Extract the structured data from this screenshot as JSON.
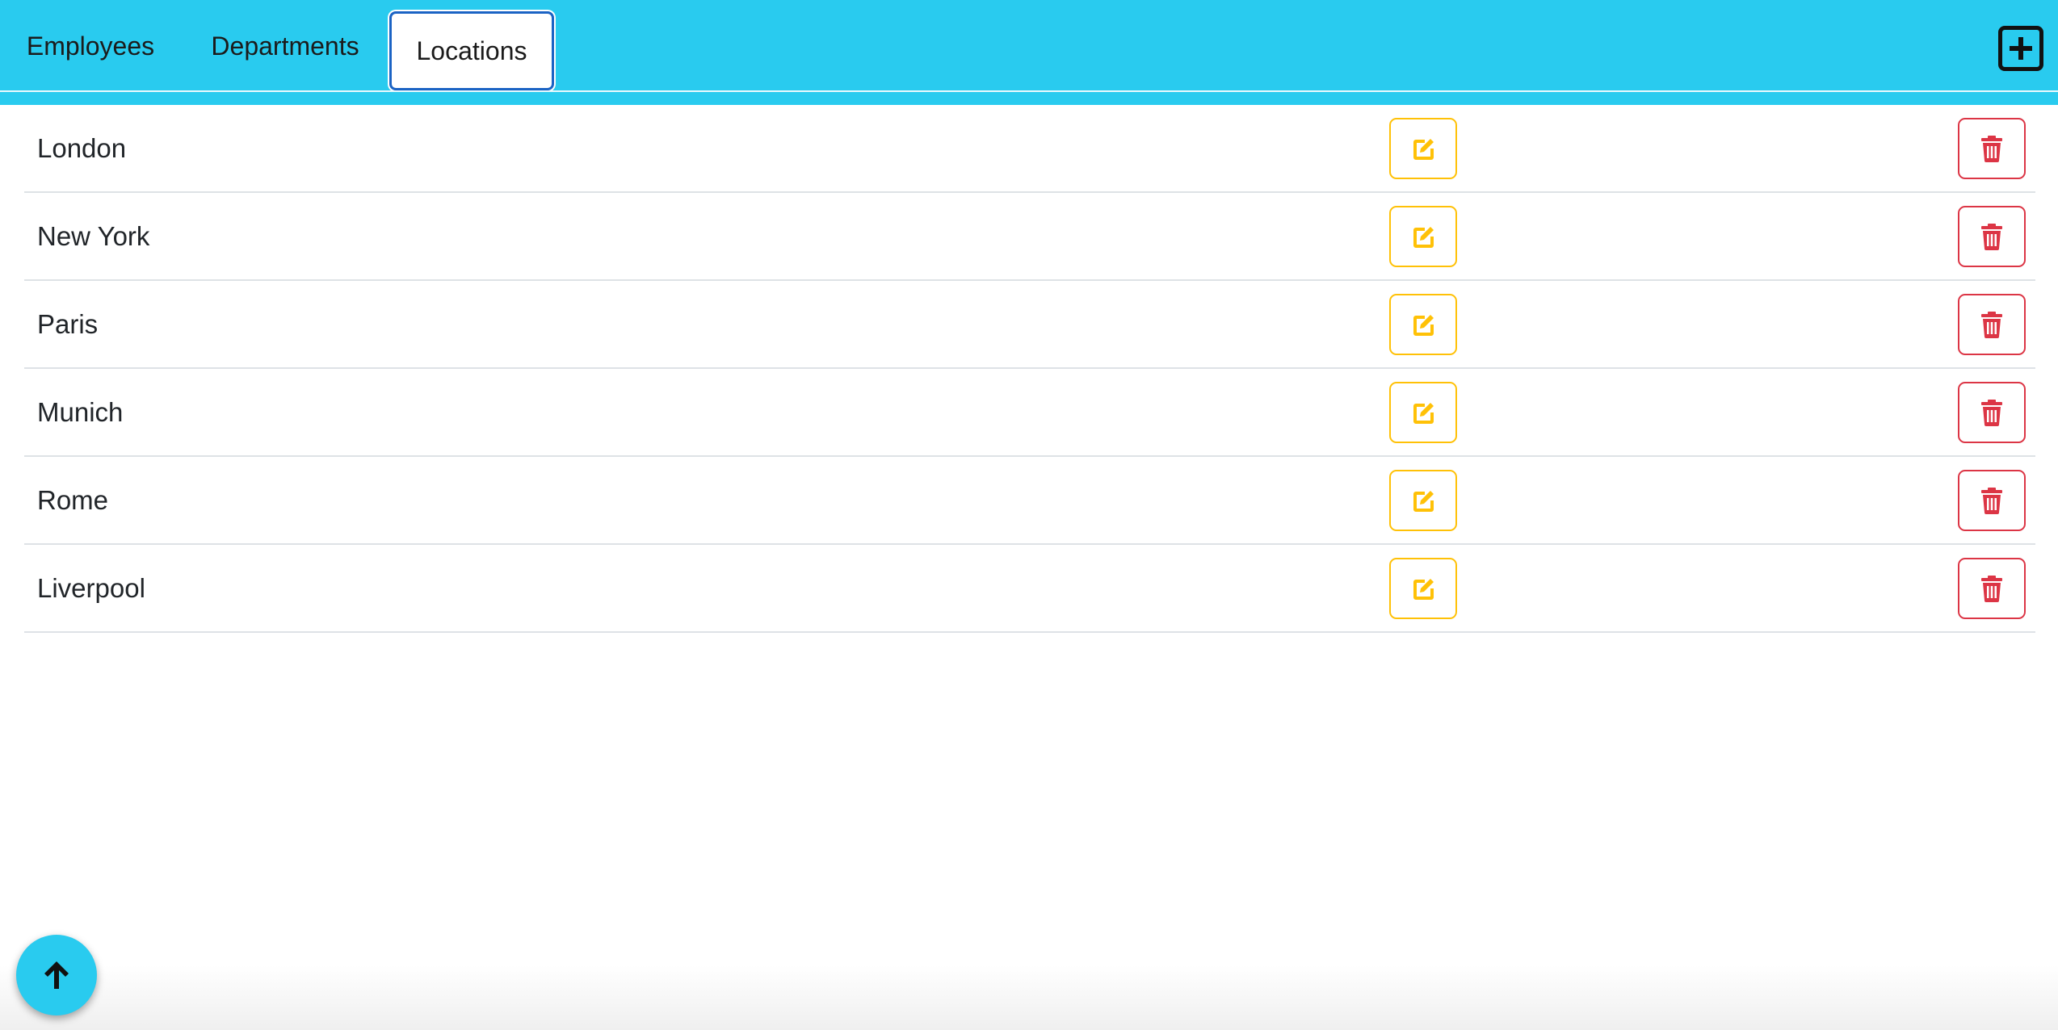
{
  "tabs": [
    {
      "label": "Employees",
      "active": false
    },
    {
      "label": "Departments",
      "active": false
    },
    {
      "label": "Locations",
      "active": true
    }
  ],
  "header": {
    "add_icon": "plus-square-icon",
    "background": "#29cbef"
  },
  "locations": [
    {
      "name": "London"
    },
    {
      "name": "New York"
    },
    {
      "name": "Paris"
    },
    {
      "name": "Munich"
    },
    {
      "name": "Rome"
    },
    {
      "name": "Liverpool"
    }
  ],
  "row_actions": {
    "edit_icon": "edit-icon",
    "delete_icon": "trash-icon",
    "edit_color": "#ffc107",
    "delete_color": "#dc3545"
  },
  "scroll_top": {
    "icon": "arrow-up-icon"
  }
}
